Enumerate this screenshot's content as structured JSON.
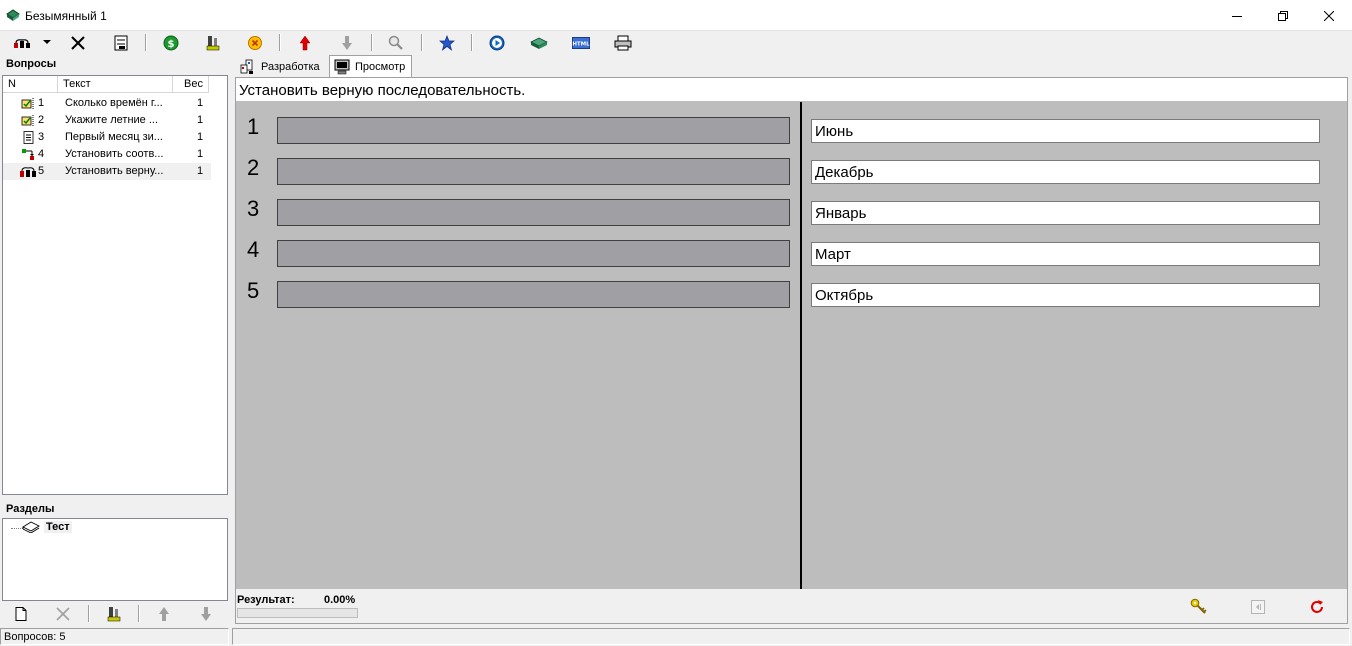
{
  "window": {
    "title": "Безымянный 1",
    "controls": [
      "minimize-icon",
      "restore-icon",
      "close-icon"
    ]
  },
  "toolbar": {
    "buttons": [
      "question-type-icon",
      "dropdown-arrow-icon",
      "delete-icon",
      "edit-icon",
      "money-icon",
      "tools-icon",
      "cancel-icon",
      "move-up-icon",
      "move-down-icon",
      "search-icon",
      "star-icon",
      "play-icon",
      "book-icon",
      "html-icon",
      "print-icon"
    ]
  },
  "questions_panel": {
    "title": "Вопросы",
    "columns": [
      "N",
      "Текст",
      "Вес"
    ],
    "rows": [
      {
        "n": "1",
        "text": "Сколько времён г...",
        "weight": "1",
        "icon": "single-choice-icon"
      },
      {
        "n": "2",
        "text": "Укажите летние ...",
        "weight": "1",
        "icon": "multiple-choice-icon"
      },
      {
        "n": "3",
        "text": "Первый месяц зи...",
        "weight": "1",
        "icon": "text-input-icon"
      },
      {
        "n": "4",
        "text": "Установить соотв...",
        "weight": "1",
        "icon": "matching-icon"
      },
      {
        "n": "5",
        "text": "Установить верну...",
        "weight": "1",
        "icon": "ordering-icon"
      }
    ],
    "selected_index": 4
  },
  "sections_panel": {
    "title": "Разделы",
    "items": [
      {
        "label": "Тест",
        "icon": "book-icon"
      }
    ]
  },
  "left_bottom_tools": [
    "new-icon",
    "delete-icon",
    "tools-icon",
    "move-up-icon",
    "move-down-icon"
  ],
  "status": {
    "count_text": "Вопросов: 5"
  },
  "tabs": [
    {
      "label": "Разработка",
      "icon": "design-icon",
      "active": false
    },
    {
      "label": "Просмотр",
      "icon": "monitor-icon",
      "active": true
    }
  ],
  "preview": {
    "question": "Установить верную последовательность.",
    "slots": [
      "1",
      "2",
      "3",
      "4",
      "5"
    ],
    "answers": [
      "Июнь",
      "Декабрь",
      "Январь",
      "Март",
      "Октябрь"
    ],
    "result_label": "Результат:",
    "result_value": "0.00%",
    "progress": 0,
    "bottom_buttons": [
      "key-icon",
      "back-icon",
      "refresh-icon"
    ]
  },
  "colors": {
    "preview_bg": "#bdbdbd",
    "slot_fill": "#a0a0a4",
    "panel_bg": "#f0f0f0"
  }
}
